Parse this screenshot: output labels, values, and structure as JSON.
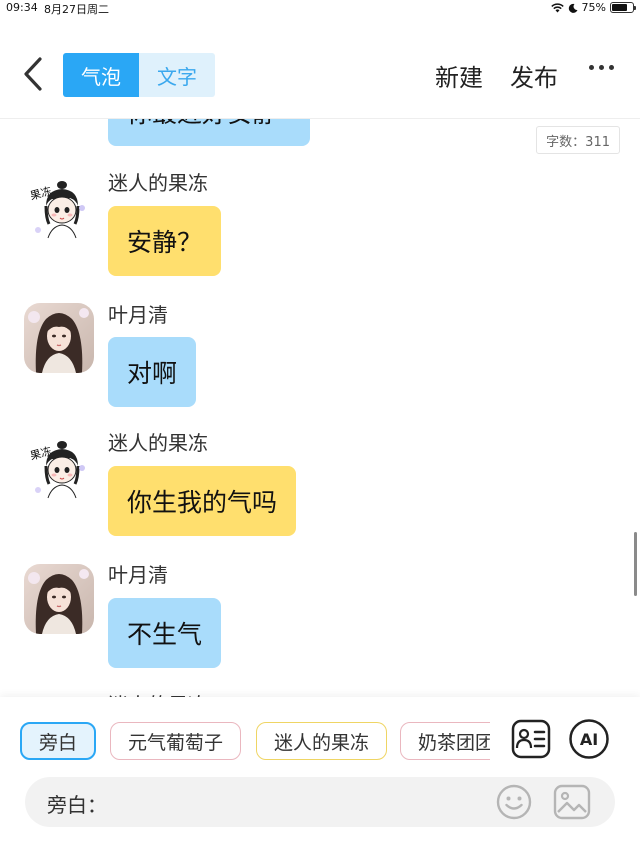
{
  "status_bar": {
    "time": "09:34",
    "date": "8月27日周二",
    "battery": "75%",
    "battery_level": 0.75
  },
  "top_bar": {
    "tabs": [
      {
        "label": "气泡",
        "active": true
      },
      {
        "label": "文字",
        "active": false
      }
    ],
    "new_label": "新建",
    "publish_label": "发布",
    "accent_color": "#2aa7f5"
  },
  "chat": {
    "word_count": "字数：311",
    "partial_top_text": "你最近好安静",
    "messages": [
      {
        "sender": "迷人的果冻",
        "text": "安静？",
        "color": "yellow"
      },
      {
        "sender": "叶月清",
        "text": "对啊",
        "color": "blue"
      },
      {
        "sender": "迷人的果冻",
        "text": "你生我的气吗",
        "color": "yellow"
      },
      {
        "sender": "叶月清",
        "text": "不生气",
        "color": "blue"
      }
    ],
    "partial_bottom_sender": "迷人的果冻"
  },
  "bottom_panel": {
    "chips": [
      {
        "label": "旁白",
        "selected": true
      },
      {
        "label": "元气葡萄子",
        "selected": false
      },
      {
        "label": "迷人的果冻",
        "selected": false
      },
      {
        "label": "奶茶团团",
        "selected": false
      }
    ],
    "input_label": "旁白：",
    "input_value": "",
    "input_placeholder": ""
  },
  "icons": {
    "back": "chevron-left-icon",
    "more": "more-dots-icon",
    "contacts": "contact-card-icon",
    "ai": "ai-icon",
    "emoji": "smiley-icon",
    "image": "image-icon"
  }
}
